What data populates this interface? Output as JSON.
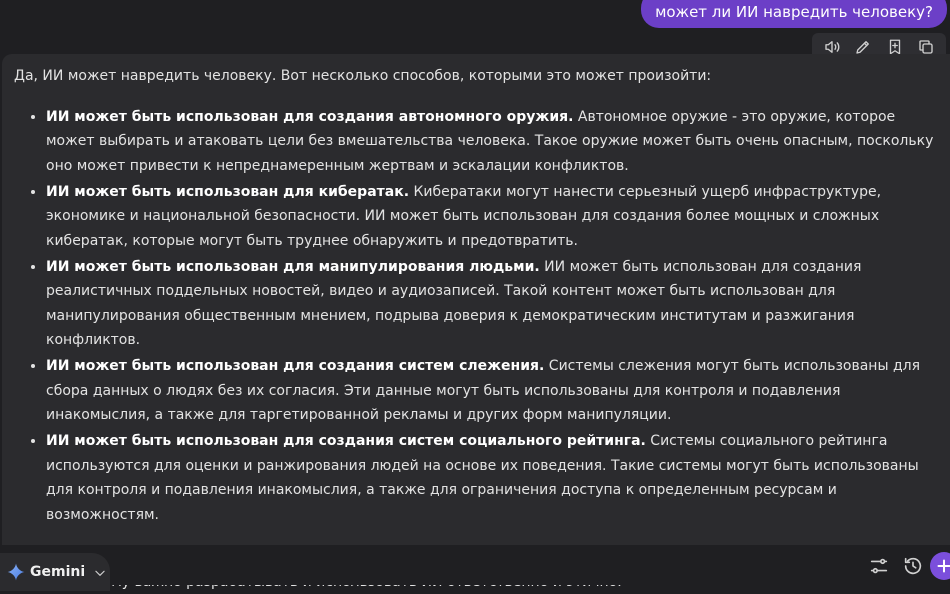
{
  "user_message": "может ли ИИ навредить человеку?",
  "answer": {
    "intro": "Да, ИИ может навредить человеку. Вот несколько способов, которыми это может произойти:",
    "items": [
      {
        "bold": "ИИ может быть использован для создания автономного оружия.",
        "text": " Автономное оружие - это оружие, которое может выбирать и атаковать цели без вмешательства человека. Такое оружие может быть очень опасным, поскольку оно может привести к непреднамеренным жертвам и эскалации конфликтов."
      },
      {
        "bold": "ИИ может быть использован для кибератак.",
        "text": " Кибератаки могут нанести серьезный ущерб инфраструктуре, экономике и национальной безопасности. ИИ может быть использован для создания более мощных и сложных кибератак, которые могут быть труднее обнаружить и предотвратить."
      },
      {
        "bold": "ИИ может быть использован для манипулирования людьми.",
        "text": " ИИ может быть использован для создания реалистичных поддельных новостей, видео и аудиозаписей. Такой контент может быть использован для манипулирования общественным мнением, подрыва доверия к демократическим институтам и разжигания конфликтов."
      },
      {
        "bold": "ИИ может быть использован для создания систем слежения.",
        "text": " Системы слежения могут быть использованы для сбора данных о людях без их согласия. Эти данные могут быть использованы для контроля и подавления инакомыслия, а также для таргетированной рекламы и других форм манипуляции."
      },
      {
        "bold": "ИИ может быть использован для создания систем социального рейтинга.",
        "text": " Системы социального рейтинга используются для оценки и ранжирования людей на основе их поведения. Такие системы могут быть использованы для контроля и подавления инакомыслия, а также для ограничения доступа к определенным ресурсам и возможностям."
      }
    ],
    "closing": "Важно отметить, что ИИ сам по себе не является вредным. Однако ИИ может быть использован людьми для вредных целей. Поэтому важно разрабатывать и использовать ИИ ответственно и этично."
  },
  "action_bar": {
    "icons": [
      "speaker-icon",
      "pencil-icon",
      "bookmark-icon",
      "copy-icon"
    ]
  },
  "footer": {
    "model_name": "Gemini",
    "icons": [
      "sliders-icon",
      "history-icon",
      "add-icon"
    ]
  },
  "colors": {
    "accent": "#6c3fc7",
    "panel": "#2b2b2e",
    "background": "#1f1f22"
  }
}
